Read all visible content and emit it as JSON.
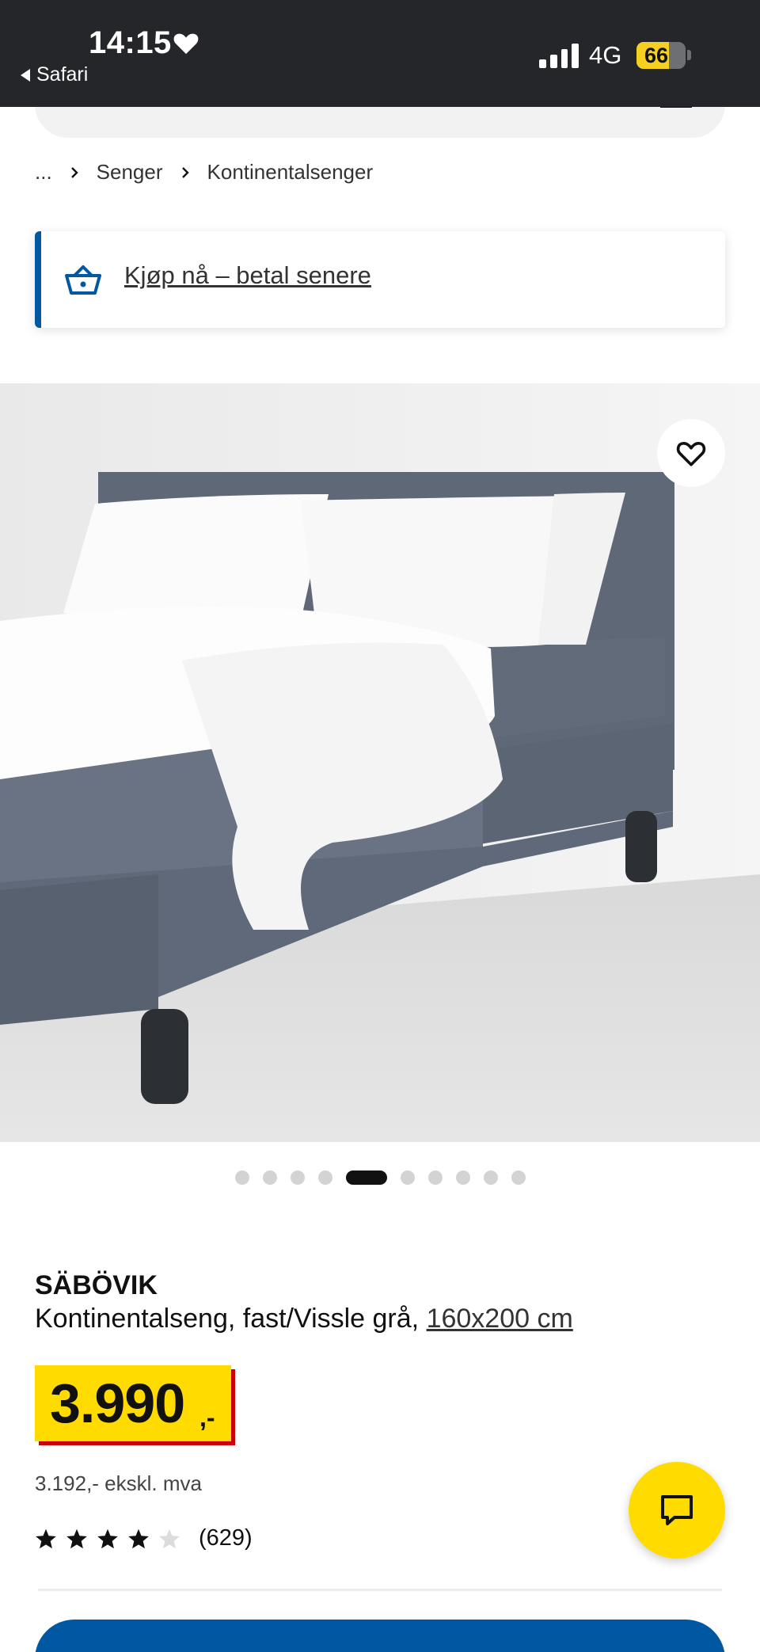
{
  "status_bar": {
    "time": "14:15",
    "back_label": "Safari",
    "network": "4G",
    "battery_level": "66",
    "battery_fraction": 0.66
  },
  "breadcrumb": {
    "ellipsis": "...",
    "items": [
      "Senger",
      "Kontinentalsenger"
    ]
  },
  "promo": {
    "label": "Kjøp nå – betal senere",
    "accent_color": "#0058a3"
  },
  "gallery": {
    "image_count": 10,
    "active_index": 4
  },
  "product": {
    "name": "SÄBÖVIK",
    "description": "Kontinentalseng, fast/Vissle grå, ",
    "size_link": "160x200 cm",
    "price": "3.990",
    "price_suffix": ",-",
    "price_excl_vat": "3.192,- ekskl. mva",
    "rating": 4,
    "rating_max": 5,
    "review_count": "(629)"
  },
  "colors": {
    "brand_blue": "#0058a3",
    "brand_yellow": "#ffdb00",
    "price_red": "#cc0008"
  }
}
